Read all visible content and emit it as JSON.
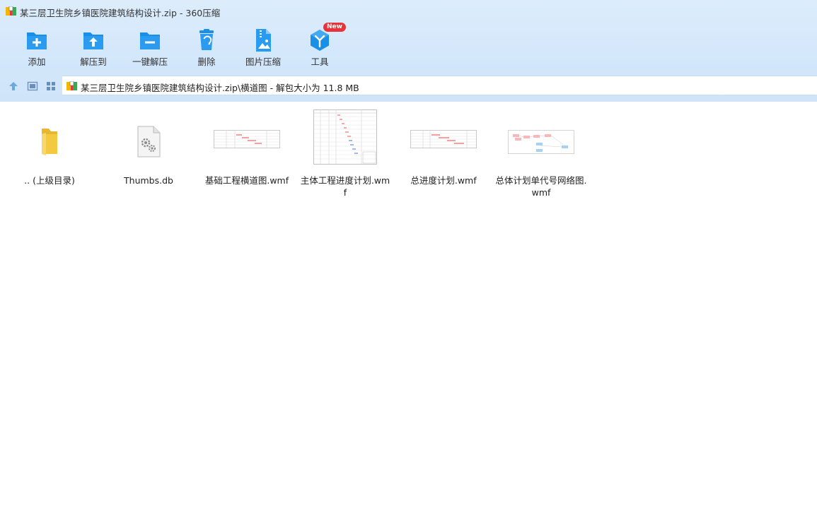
{
  "window": {
    "title": "某三层卫生院乡镇医院建筑结构设计.zip - 360压缩"
  },
  "toolbar": {
    "items": [
      {
        "label": "添加",
        "icon": "add-folder-icon"
      },
      {
        "label": "解压到",
        "icon": "extract-to-icon"
      },
      {
        "label": "一键解压",
        "icon": "one-click-extract-icon"
      },
      {
        "label": "删除",
        "icon": "delete-trash-icon"
      },
      {
        "label": "图片压缩",
        "icon": "image-compress-icon"
      },
      {
        "label": "工具",
        "icon": "tools-icon",
        "badge": "New"
      }
    ]
  },
  "nav": {
    "path": "某三层卫生院乡镇医院建筑结构设计.zip\\横道图 - 解包大小为 11.8 MB"
  },
  "files": [
    {
      "name": ".. (上级目录)",
      "kind": "parent-folder"
    },
    {
      "name": "Thumbs.db",
      "kind": "system-file"
    },
    {
      "name": "基础工程横道图.wmf",
      "kind": "wmf-wide"
    },
    {
      "name": "主体工程进度计划.wmf",
      "kind": "wmf-tall"
    },
    {
      "name": "总进度计划.wmf",
      "kind": "wmf-wide"
    },
    {
      "name": "总体计划单代号网络图.wmf",
      "kind": "wmf-network"
    }
  ],
  "colors": {
    "toolbar_bg": "#d3e7fb",
    "icon_blue": "#1a8fe8",
    "badge_red": "#e8333a",
    "folder_yellow": "#f5c842"
  }
}
